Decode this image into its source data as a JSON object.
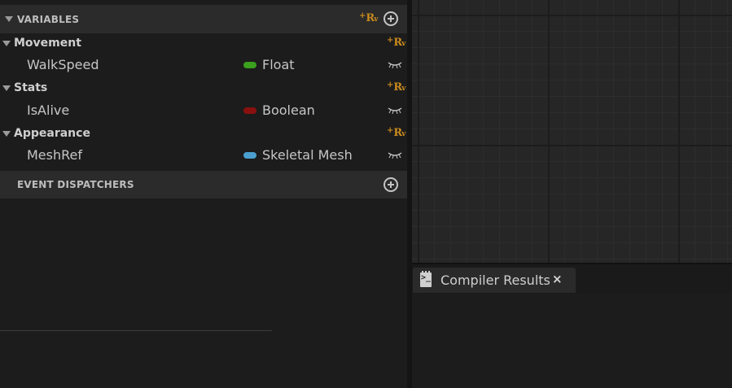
{
  "variables": {
    "header": "VARIABLES",
    "categories": [
      {
        "name": "Movement",
        "vars": [
          {
            "name": "WalkSpeed",
            "type": "Float",
            "pin_color": "#3aa01d"
          }
        ]
      },
      {
        "name": "Stats",
        "vars": [
          {
            "name": "IsAlive",
            "type": "Boolean",
            "pin_color": "#8a1010"
          }
        ]
      },
      {
        "name": "Appearance",
        "vars": [
          {
            "name": "MeshRef",
            "type": "Skeletal Mesh",
            "pin_color": "#4a9fcf"
          }
        ]
      }
    ]
  },
  "event_dispatchers": {
    "header": "EVENT DISPATCHERS"
  },
  "compiler_results": {
    "tab_label": "Compiler Results",
    "close_glyph": "×"
  },
  "icons": {
    "add": "plus-circle-icon",
    "add_variable": "add-variable-icon",
    "visibility": "closed-eye-icon",
    "collapse": "triangle-down-icon",
    "console": "console-icon"
  },
  "colors": {
    "accent_orange": "#c98a1d",
    "panel_bg": "#1c1c1c",
    "header_bg": "#2b2b2b"
  }
}
